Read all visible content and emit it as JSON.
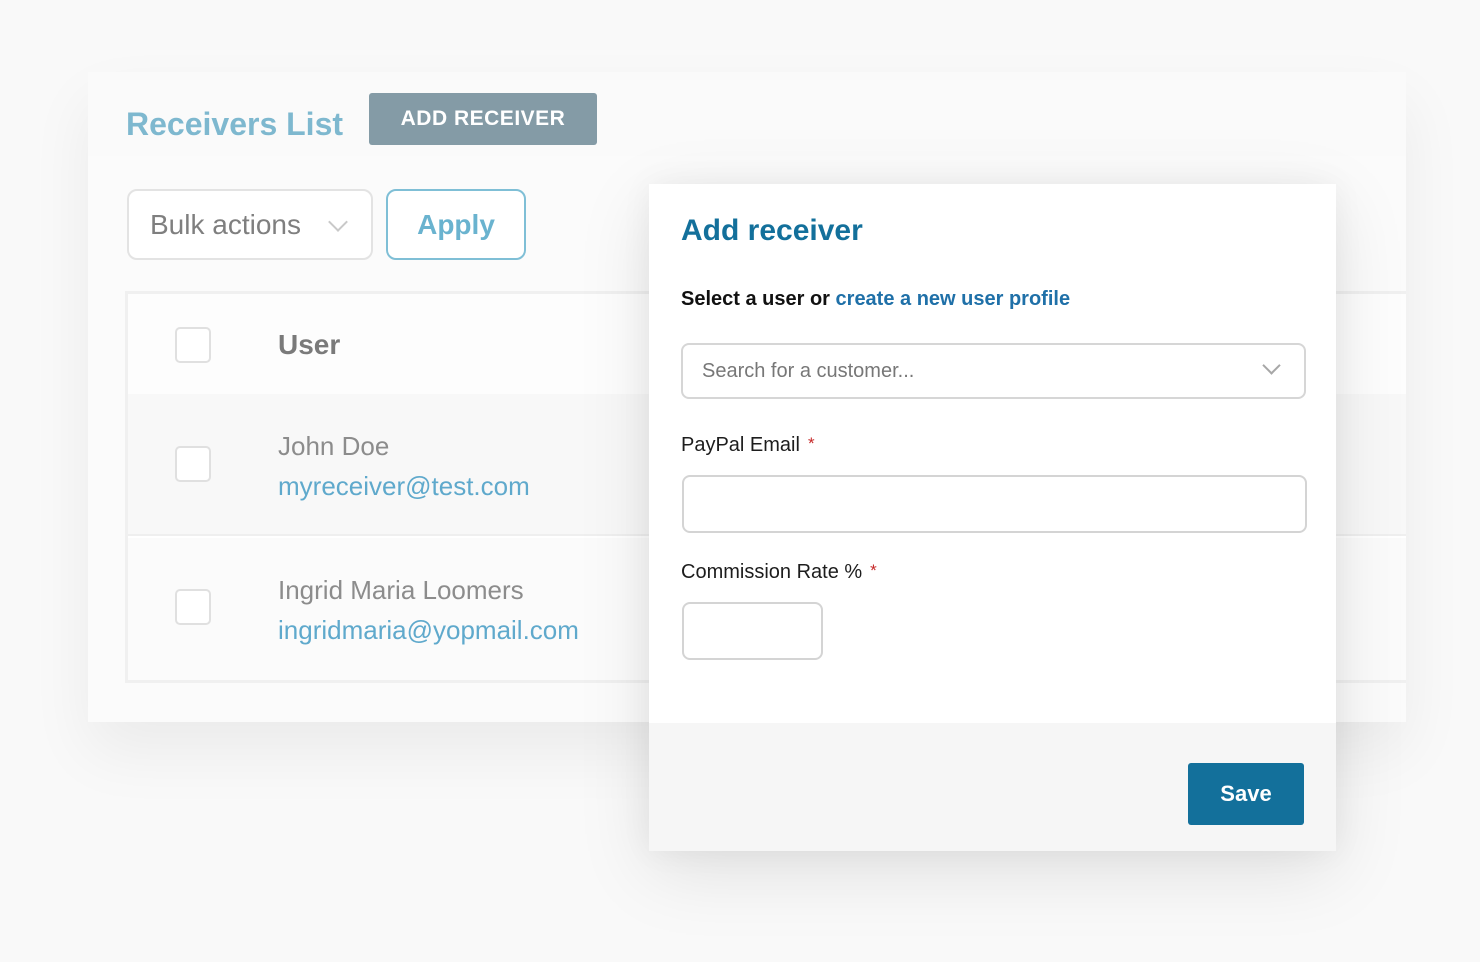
{
  "list": {
    "title": "Receivers List",
    "add_button_label": "ADD RECEIVER",
    "bulk_actions_label": "Bulk actions",
    "apply_label": "Apply",
    "columns": [
      "User"
    ],
    "rows": [
      {
        "name": "John Doe",
        "email": "myreceiver@test.com"
      },
      {
        "name": "Ingrid Maria Loomers",
        "email": "ingridmaria@yopmail.com"
      }
    ]
  },
  "modal": {
    "title": "Add receiver",
    "select_prefix": "Select a user or ",
    "select_link": "create a new user profile",
    "search_placeholder": "Search for a customer...",
    "paypal_label": "PayPal Email",
    "commission_label": "Commission Rate %",
    "required_marker": "*",
    "paypal_value": "",
    "commission_value": "",
    "save_label": "Save"
  },
  "colors": {
    "accent": "#13709b",
    "title_light": "#7eb8cf",
    "add_button_bg": "#849ba6",
    "link": "#1f70a8",
    "required": "#c62828"
  },
  "icons": [
    "chevron-down-icon"
  ]
}
